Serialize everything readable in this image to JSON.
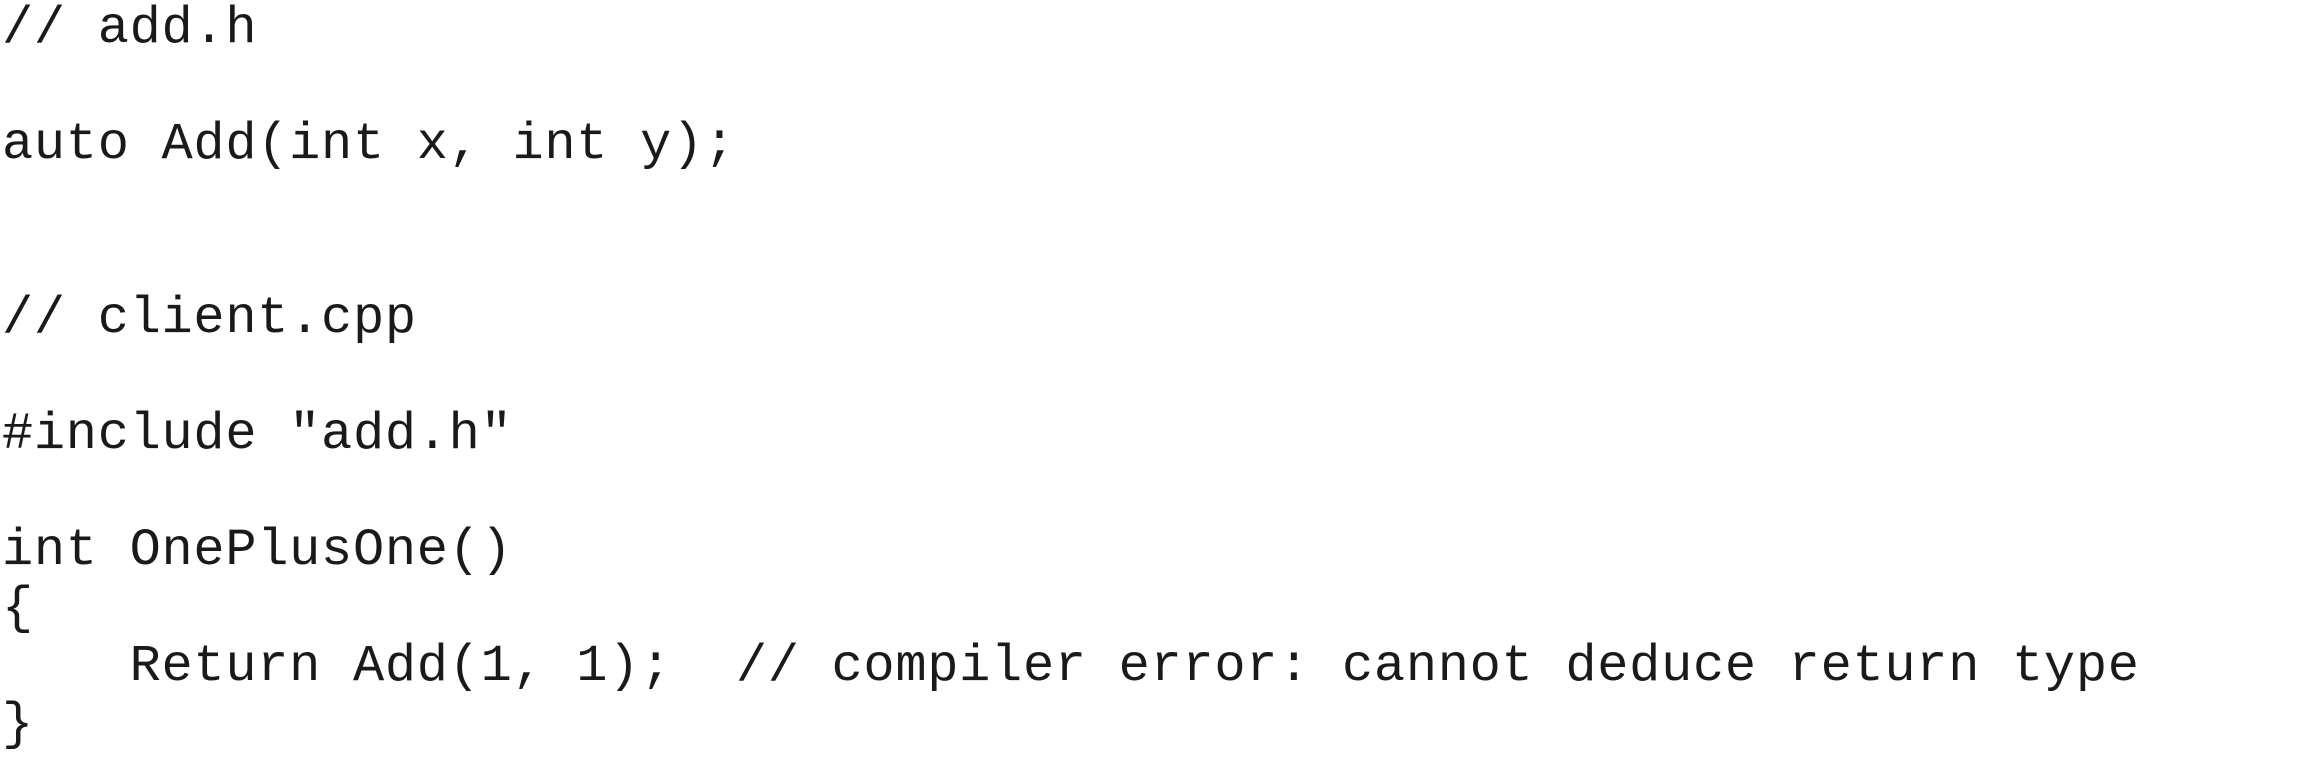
{
  "document": {
    "lines": [
      "// add.h",
      "auto Add(int x, int y);",
      "// client.cpp",
      "#include \"add.h\"",
      "int OnePlusOne()",
      "{",
      "    Return Add(1, 1);  // compiler error: cannot deduce return type",
      "}"
    ]
  }
}
